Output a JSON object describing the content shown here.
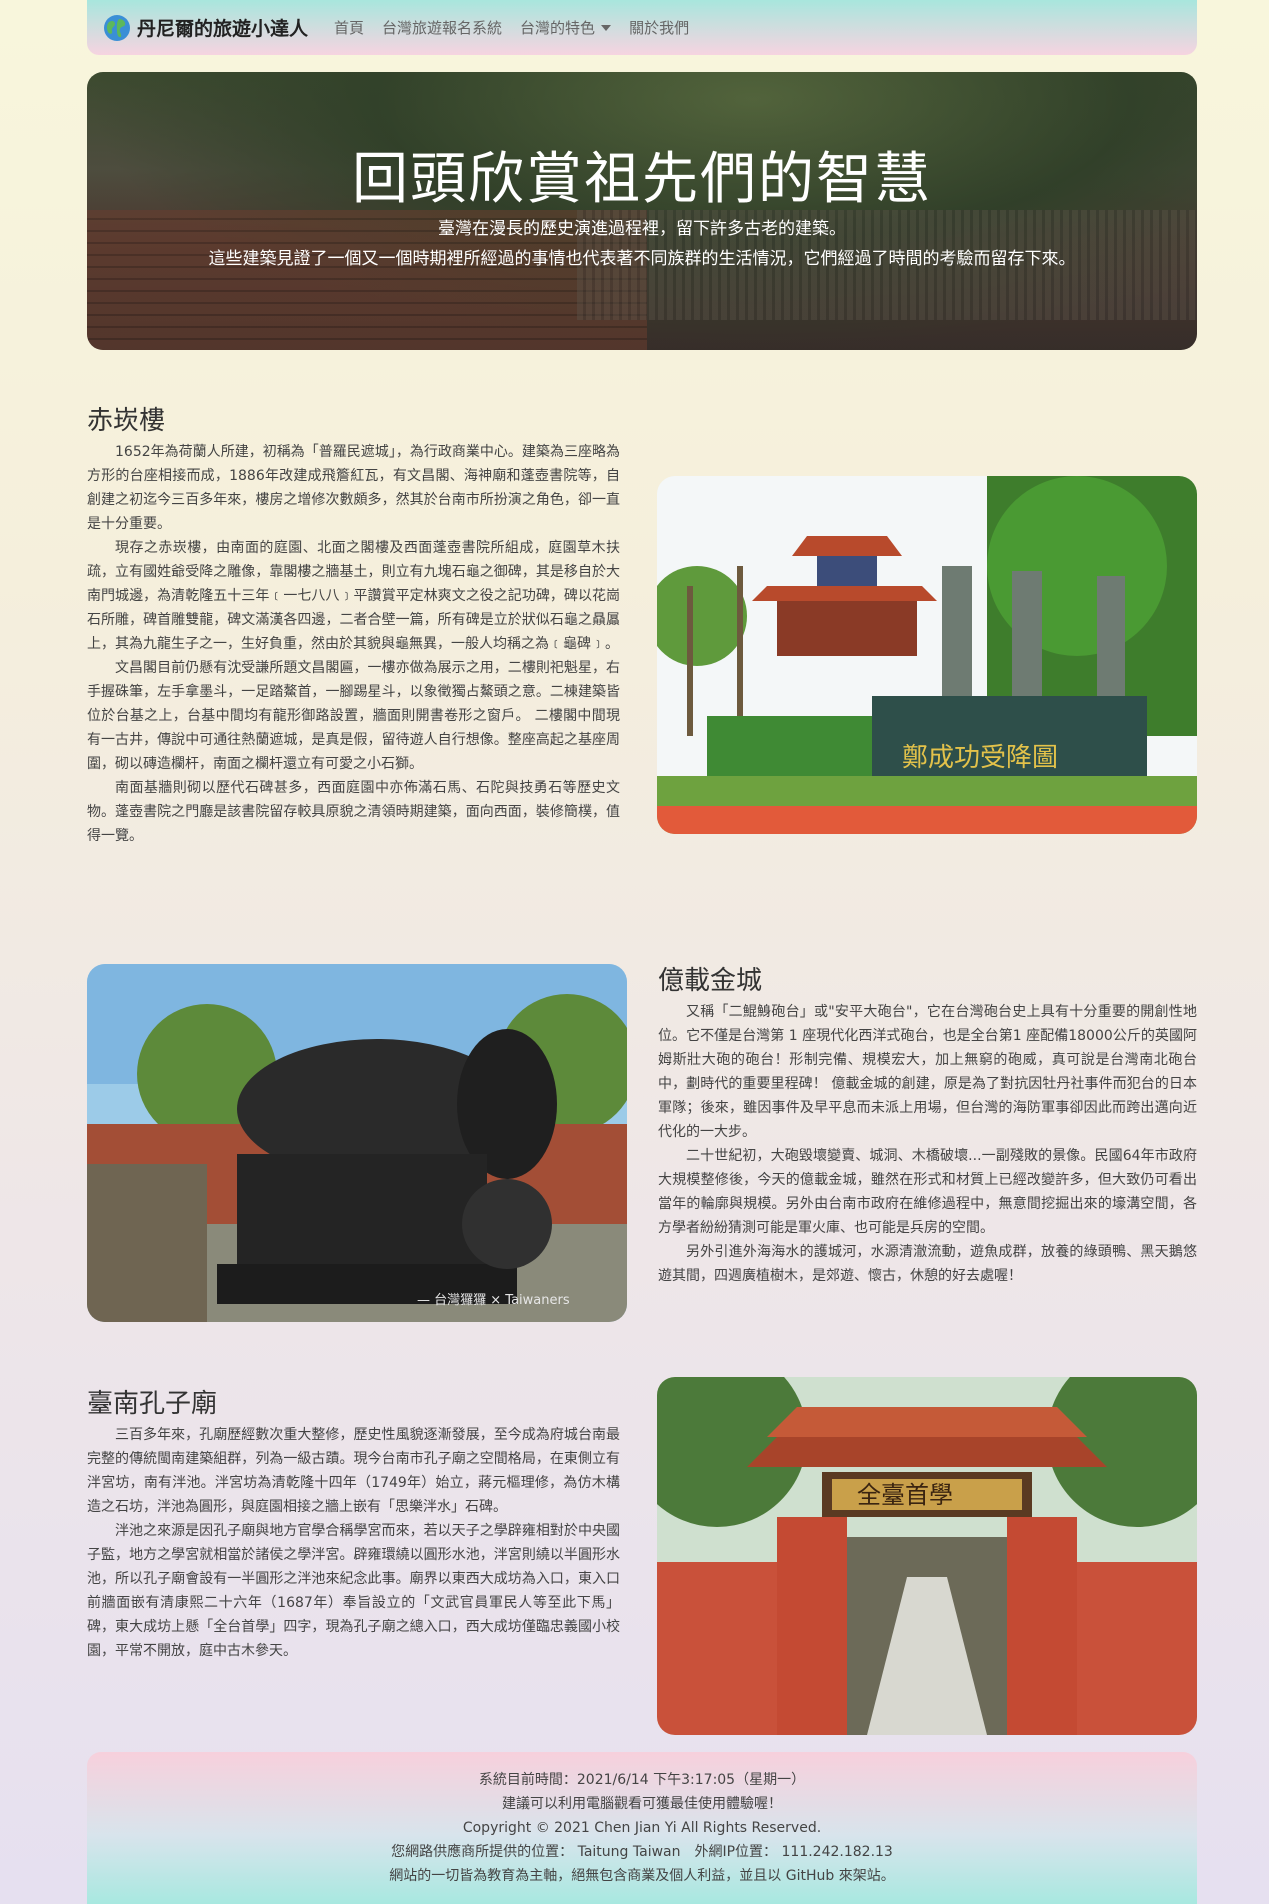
{
  "nav": {
    "brand": "丹尼爾的旅遊小達人",
    "links": [
      "首頁",
      "台灣旅遊報名系統",
      "台灣的特色",
      "關於我們"
    ]
  },
  "hero": {
    "title": "回頭欣賞祖先們的智慧",
    "line1": "臺灣在漫長的歷史演進過程裡，留下許多古老的建築。",
    "line2": "這些建築見證了一個又一個時期裡所經過的事情也代表著不同族群的生活情況，它們經過了時間的考驗而留存下來。"
  },
  "sections": [
    {
      "title": "赤崁樓",
      "paragraphs": [
        "1652年為荷蘭人所建，初稱為「普羅民遮城」，為行政商業中心。建築為三座略為方形的台座相接而成，1886年改建成飛簷紅瓦，有文昌閣、海神廟和蓬壺書院等，自創建之初迄今三百多年來，樓房之增修次數頗多，然其於台南市所扮演之角色，卻一直是十分重要。",
        "現存之赤崁樓，由南面的庭園、北面之閣樓及西面蓬壺書院所組成，庭園草木扶疏，立有國姓爺受降之雕像，靠閣樓之牆基土，則立有九塊石龜之御碑，其是移自於大南門城邊，為清乾隆五十三年﹝一七八八﹞平讚賞平定林爽文之役之記功碑，碑以花崗石所雕，碑首雕雙龍，碑文滿漢各四邊，二者合壁一篇，所有碑是立於狀似石龜之贔屭上，其為九龍生子之一，生好負重，然由於其貌與龜無異，一般人均稱之為﹝龜碑﹞。",
        "文昌閣目前仍懸有沈受謙所題文昌閣匾，一樓亦做為展示之用，二樓則祀魁星，右手握硃筆，左手拿墨斗，一足踏鰲首，一腳踢星斗，以象徵獨占鰲頭之意。二棟建築皆位於台基之上，台基中間均有龍形御路設置，牆面則開書卷形之窗戶。 二樓閣中間現有一古井，傳說中可通往熱蘭遮城，是真是假，留待遊人自行想像。整座高起之基座周圍，砌以磚造欄杆，南面之欄杆還立有可愛之小石獅。",
        "南面基牆則砌以歷代石碑甚多，西面庭園中亦佈滿石馬、石陀與技勇石等歷史文物。蓬壺書院之門廳是該書院留存較具原貌之清領時期建築，面向西面，裝修簡樸，值得一覽。"
      ]
    },
    {
      "title": "億載金城",
      "paragraphs": [
        "又稱「二鯤鯓砲台」或\"安平大砲台\"，它在台灣砲台史上具有十分重要的開創性地位。它不僅是台灣第 1 座現代化西洋式砲台，也是全台第1 座配備18000公斤的英國阿姆斯壯大砲的砲台！形制完備、規模宏大，加上無窮的砲威，真可說是台灣南北砲台中，劃時代的重要里程碑！ 億載金城的創建，原是為了對抗因牡丹社事件而犯台的日本軍隊；後來，雖因事件及早平息而未派上用場，但台灣的海防軍事卻因此而跨出邁向近代化的一大步。",
        "二十世紀初，大砲毀壞變賣、城洞、木橋破壞...一副殘敗的景像。民國64年市政府大規模整修後，今天的億載金城，雖然在形式和材質上已經改變許多，但大致仍可看出當年的輪廓與規模。另外由台南市政府在維修過程中，無意間挖掘出來的壕溝空間，各方學者紛紛猜測可能是軍火庫、也可能是兵房的空間。",
        "另外引進外海海水的護城河，水源清澈流動，遊魚成群，放養的綠頭鴨、黑天鵝悠遊其間，四週廣植樹木，是郊遊、懷古，休憩的好去處喔！"
      ]
    },
    {
      "title": "臺南孔子廟",
      "paragraphs": [
        "三百多年來，孔廟歷經數次重大整修，歷史性風貌逐漸發展，至今成為府城台南最完整的傳統閩南建築組群，列為一級古蹟。現今台南市孔子廟之空間格局，在東側立有泮宮坊，南有泮池。泮宮坊為清乾隆十四年（1749年）始立，蔣元樞理修，為仿木構造之石坊，泮池為圓形，與庭園相接之牆上嵌有「思樂泮水」石碑。",
        "泮池之來源是因孔子廟與地方官學合稱學宮而來，若以天子之學辟雍相對於中央國子監，地方之學宮就相當於諸侯之學泮宮。辟雍環繞以圓形水池，泮宮則繞以半圓形水池，所以孔子廟會設有一半圓形之泮池來紀念此事。廟界以東西大成坊為入口，東入口前牆面嵌有清康熙二十六年（1687年）奉旨設立的「文武官員軍民人等至此下馬」碑，東大成坊上懸「全台首學」四字，現為孔子廟之總入口，西大成坊僅臨忠義國小校園，平常不開放，庭中古木參天。"
      ]
    }
  ],
  "photo_captions": {
    "chikan_plaque": "鄭成功受降圖",
    "watermark": "— 台灣玀玀 × Taiwaners",
    "confucius_plaque": "全臺首學"
  },
  "footer": {
    "time": "系統目前時間：2021/6/14 下午3:17:05（星期一）",
    "tip": "建議可以利用電腦觀看可獲最佳使用體驗喔！",
    "copyright": "Copyright © 2021 Chen Jian Yi All Rights Reserved.",
    "location": "您網路供應商所提供的位置： Taitung Taiwan　外網IP位置： 111.242.182.13",
    "note": "網站的一切皆為教育為主軸，絕無包含商業及個人利益，並且以 GitHub 來架站。"
  }
}
